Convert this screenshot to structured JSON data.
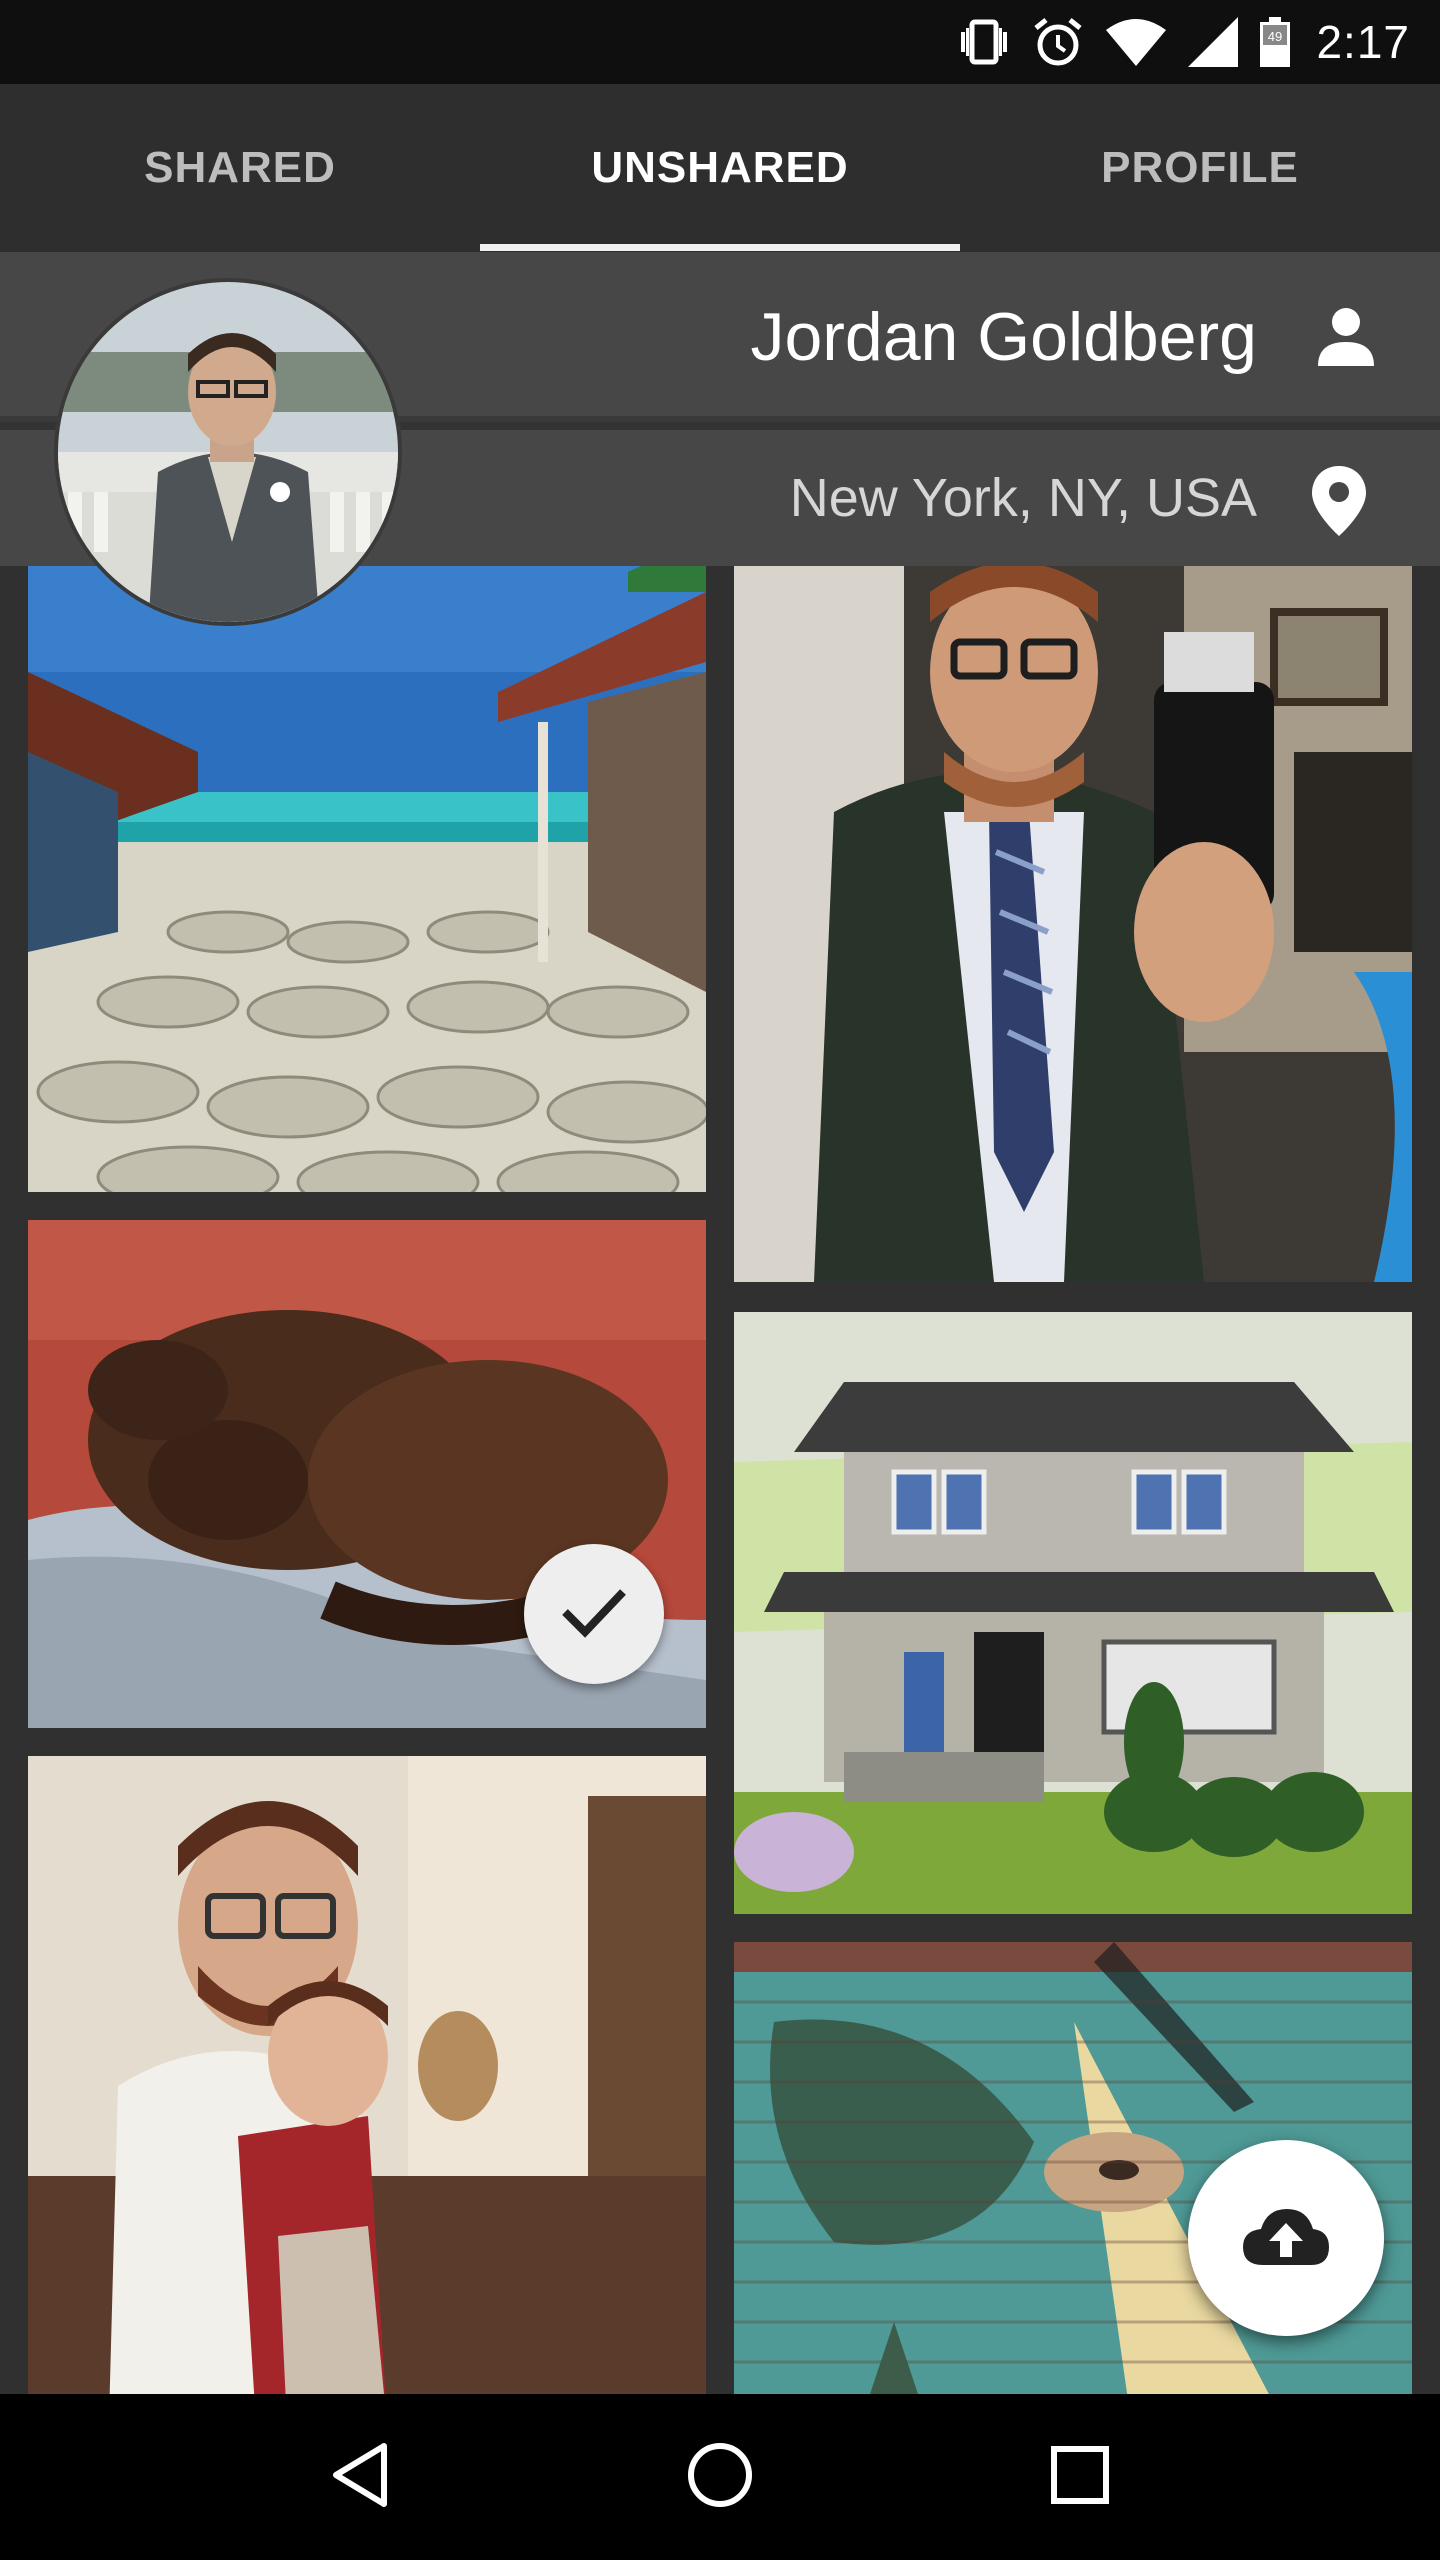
{
  "status_bar": {
    "time": "2:17",
    "battery_level": "49",
    "icons": [
      "vibrate-icon",
      "alarm-icon",
      "wifi-icon",
      "signal-icon",
      "battery-icon"
    ]
  },
  "tabs": [
    {
      "label": "SHARED",
      "active": false
    },
    {
      "label": "UNSHARED",
      "active": true
    },
    {
      "label": "PROFILE",
      "active": false
    }
  ],
  "profile": {
    "name": "Jordan Goldberg",
    "location": "New York, NY, USA"
  },
  "photos": [
    {
      "subject": "beach walkway",
      "selected": false
    },
    {
      "subject": "man selfie in mirror",
      "selected": false
    },
    {
      "subject": "sleeping dog",
      "selected": true
    },
    {
      "subject": "mosaic house",
      "selected": false
    },
    {
      "subject": "father and child",
      "selected": false
    },
    {
      "subject": "brick wall mural",
      "selected": false
    }
  ],
  "fab": {
    "icon": "cloud-upload-icon"
  },
  "nav": [
    "back-icon",
    "home-icon",
    "recents-icon"
  ],
  "colors": {
    "status_bar": "#0f0f0f",
    "tab_bar": "#2e2e2e",
    "header_rows": "#474747",
    "background": "#333333",
    "fab": "#ffffff"
  }
}
